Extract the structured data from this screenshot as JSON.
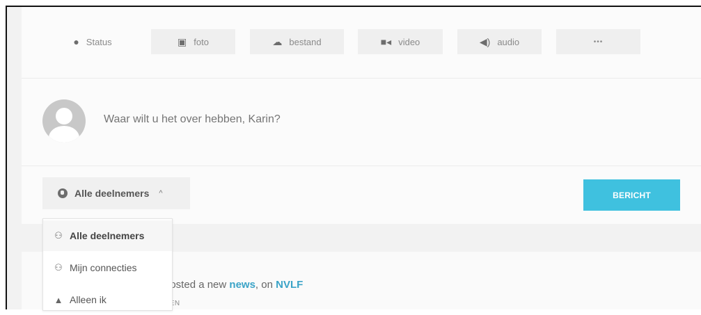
{
  "post_types": [
    {
      "label": "Status",
      "icon": "speech-bubble-icon",
      "glyph": "💬"
    },
    {
      "label": "foto",
      "icon": "camera-icon",
      "glyph": "📷"
    },
    {
      "label": "bestand",
      "icon": "cloud-upload-icon",
      "glyph": "☁"
    },
    {
      "label": "video",
      "icon": "video-camera-icon",
      "glyph": "■◀"
    },
    {
      "label": "audio",
      "icon": "speaker-icon",
      "glyph": "🔊"
    },
    {
      "label": "•••",
      "icon": "more-icon",
      "glyph": ""
    }
  ],
  "composer": {
    "placeholder": "Waar wilt u het over hebben, Karin?"
  },
  "audience": {
    "selected": "Alle deelnemers",
    "caret": "^",
    "options": [
      {
        "label": "Alle deelnemers",
        "icon": "group-icon",
        "glyph": "👥"
      },
      {
        "label": "Mijn connecties",
        "icon": "connections-icon",
        "glyph": "👥"
      },
      {
        "label": "Alleen ik",
        "icon": "lock-icon",
        "glyph": "🔒"
      }
    ]
  },
  "send_button": {
    "label": "BERICHT"
  },
  "feed": {
    "prefix": "posted a new ",
    "link1": "news",
    "middle": ", on ",
    "link2": "NVLF",
    "sub": "DEN"
  },
  "colors": {
    "accent": "#3fc1df",
    "link": "#3aa3c7"
  }
}
